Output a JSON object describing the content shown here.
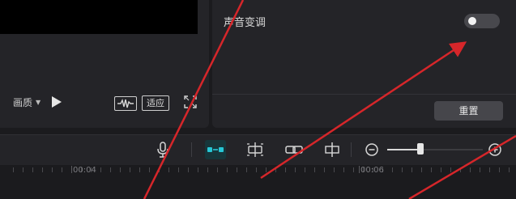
{
  "preview": {
    "quality_label": "画质",
    "adapt_label": "适应",
    "icons": {
      "play": "play-icon",
      "waveform": "waveform-icon",
      "fullscreen": "fullscreen-icon"
    }
  },
  "properties": {
    "pitch_shift_label": "声音变调",
    "pitch_shift_enabled": false,
    "reset_label": "重置"
  },
  "timeline": {
    "toolbar_icons": [
      "mic-icon",
      "link-main-track-icon",
      "preview-axis-icon",
      "link-icon",
      "split-icon",
      "zoom-out-icon",
      "zoom-in-icon"
    ],
    "zoom_level_fraction": 0.35,
    "time_markers": [
      "00:04",
      "00:06"
    ]
  },
  "colors": {
    "annotation_arrow": "#d6262a",
    "active_tool_bg": "#17363a",
    "active_tool_fg": "#27c7d6"
  }
}
